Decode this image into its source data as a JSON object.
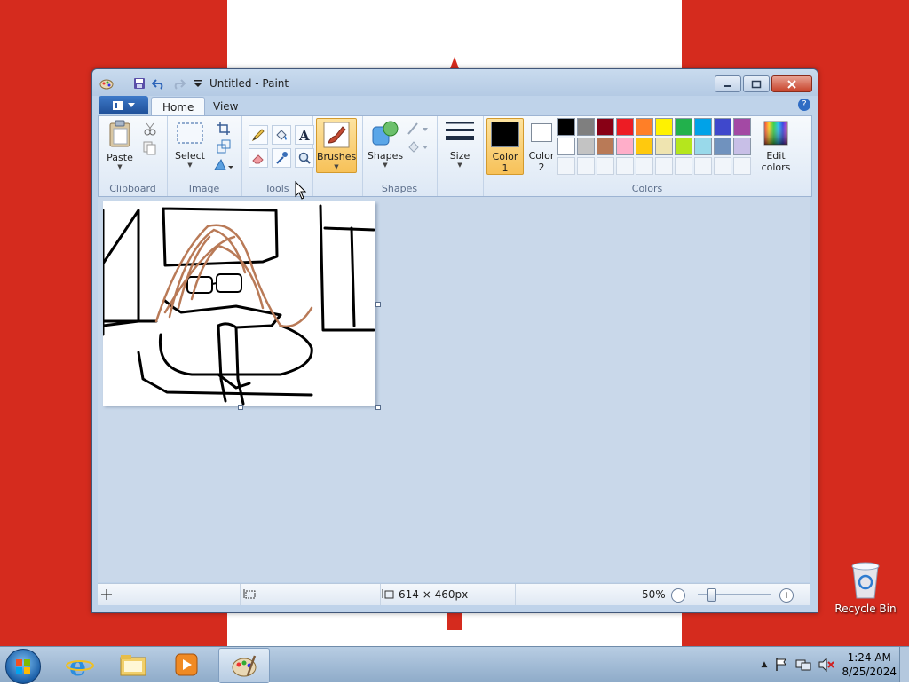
{
  "desktop": {
    "recycle_bin_label": "Recycle Bin"
  },
  "window": {
    "title": "Untitled - Paint",
    "icons": [
      "paint-app-icon",
      "save-icon",
      "undo-icon",
      "redo-icon",
      "customize-qat-icon"
    ]
  },
  "ribbon": {
    "tabs": [
      {
        "label": "Home",
        "active": true
      },
      {
        "label": "View",
        "active": false
      }
    ],
    "groups": {
      "clipboard": {
        "label": "Clipboard",
        "paste_label": "Paste"
      },
      "image": {
        "label": "Image",
        "select_label": "Select"
      },
      "tools": {
        "label": "Tools"
      },
      "brushes": {
        "label": "Brushes"
      },
      "shapes": {
        "label": "Shapes",
        "shapes_label": "Shapes"
      },
      "size": {
        "label": "Size"
      },
      "colors": {
        "label": "Colors",
        "color1_line1": "Color",
        "color1_line2": "1",
        "color2_line1": "Color",
        "color2_line2": "2",
        "edit_line1": "Edit",
        "edit_line2": "colors",
        "color1_value": "#000000",
        "color2_value": "#ffffff",
        "palette_row1": [
          "#000000",
          "#7f7f7f",
          "#880015",
          "#ed1c24",
          "#ff7f27",
          "#fff200",
          "#22b14c",
          "#00a2e8",
          "#3f48cc",
          "#a349a4"
        ],
        "palette_row2": [
          "#ffffff",
          "#c3c3c3",
          "#b97a57",
          "#ffaec9",
          "#ffc90e",
          "#efe4b0",
          "#b5e61d",
          "#99d9ea",
          "#7092be",
          "#c8bfe7"
        ]
      }
    }
  },
  "statusbar": {
    "size_text": "614 × 460px",
    "zoom": "50%"
  },
  "taskbar": {
    "time": "1:24 AM",
    "date": "8/25/2024"
  }
}
